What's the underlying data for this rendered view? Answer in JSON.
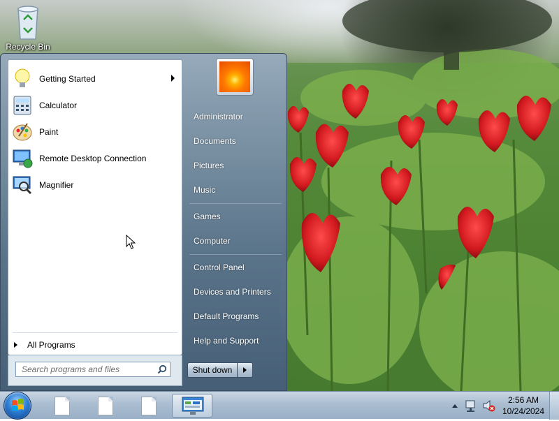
{
  "desktop": {
    "icons": [
      {
        "label": "Recycle Bin",
        "icon": "recycle-bin-icon"
      }
    ]
  },
  "start_menu": {
    "pinned_programs": [
      {
        "label": "Getting Started",
        "icon": "lightbulb-icon",
        "has_submenu": true
      },
      {
        "label": "Calculator",
        "icon": "calculator-icon",
        "has_submenu": false
      },
      {
        "label": "Paint",
        "icon": "paint-palette-icon",
        "has_submenu": false
      },
      {
        "label": "Remote Desktop Connection",
        "icon": "remote-desktop-icon",
        "has_submenu": false
      },
      {
        "label": "Magnifier",
        "icon": "magnifier-icon",
        "has_submenu": false
      }
    ],
    "all_programs_label": "All Programs",
    "search": {
      "placeholder": "Search programs and files",
      "value": ""
    },
    "user_picture": "flower-avatar-icon",
    "right_items": [
      {
        "label": "Administrator"
      },
      {
        "label": "Documents"
      },
      {
        "label": "Pictures"
      },
      {
        "label": "Music"
      },
      {
        "label": "Games"
      },
      {
        "label": "Computer"
      },
      {
        "label": "Control Panel"
      },
      {
        "label": "Devices and Printers"
      },
      {
        "label": "Default Programs"
      },
      {
        "label": "Help and Support"
      }
    ],
    "shutdown_label": "Shut down"
  },
  "taskbar": {
    "start_button": "windows-start-orb-icon",
    "pinned": [
      {
        "icon": "document-icon",
        "active": false
      },
      {
        "icon": "document-icon",
        "active": false
      },
      {
        "icon": "document-icon",
        "active": false
      },
      {
        "icon": "control-panel-window-icon",
        "active": true
      }
    ],
    "tray_icons": [
      "show-hidden-icons-icon",
      "network-icon",
      "volume-muted-icon"
    ],
    "clock": {
      "time": "2:56 AM",
      "date": "10/24/2024"
    }
  },
  "colors": {
    "start_menu_right": "#5a738c",
    "taskbar": "#aabdd1",
    "tulip_red": "#d11a1f"
  }
}
